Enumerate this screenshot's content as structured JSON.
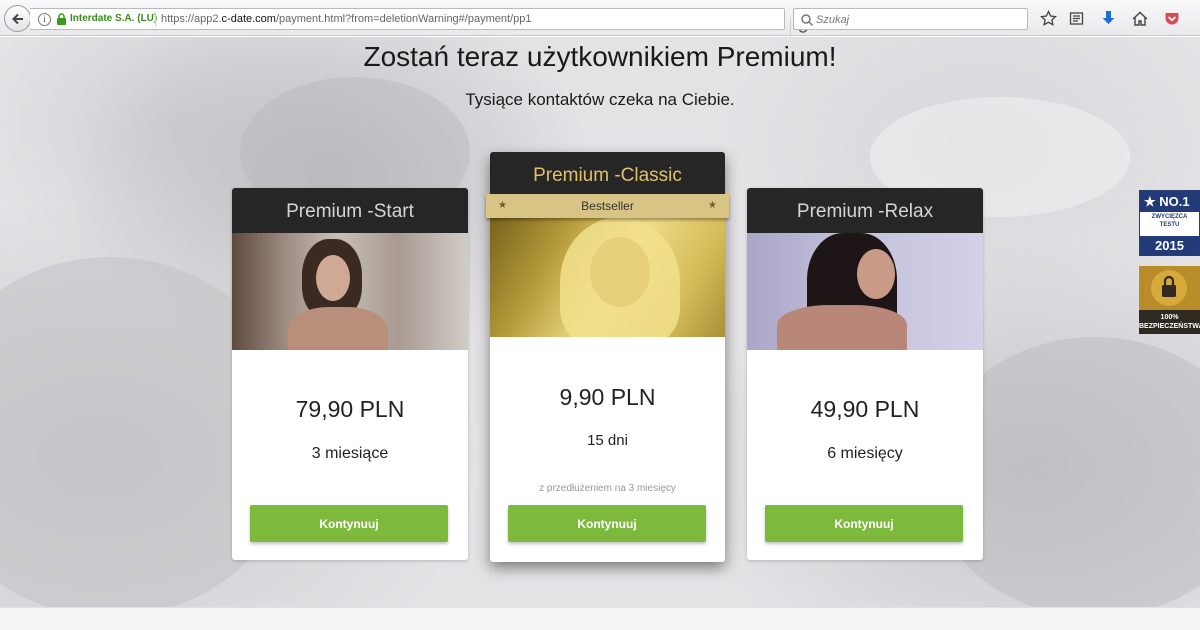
{
  "browser": {
    "site_identity": "Interdate S.A. (LU)",
    "url_prefix": "https://app2.",
    "url_domain": "c-date.com",
    "url_suffix": "/payment.html?from=deletionWarning#/payment/pp1",
    "search_placeholder": "Szukaj"
  },
  "page": {
    "title": "Zostań teraz użytkownikiem Premium!",
    "subtitle": "Tysiące kontaktów czeka na Ciebie."
  },
  "plans": [
    {
      "name": "Premium -Start",
      "price": "79,90 PLN",
      "period": "3 miesiące",
      "button": "Kontynuuj"
    },
    {
      "name": "Premium -Classic",
      "ribbon": "Bestseller",
      "price": "9,90 PLN",
      "period": "15 dni",
      "note": "z przedłużeniem na 3 miesięcy",
      "button": "Kontynuuj"
    },
    {
      "name": "Premium -Relax",
      "price": "49,90 PLN",
      "period": "6 miesięcy",
      "button": "Kontynuuj"
    }
  ],
  "badges": {
    "award_top": "NO.1",
    "award_line1": "ZWYCIĘZCA",
    "award_line2": "TESTU",
    "award_year": "2015",
    "secure_line1": "100%",
    "secure_line2": "BEZPIECZEŃSTWA"
  },
  "colors": {
    "cta_green": "#7cb93c",
    "header_dark": "#262626",
    "classic_gold": "#e0c06a",
    "ribbon_gold": "#d8c585"
  },
  "icons": [
    "back-arrow-icon",
    "info-icon",
    "lock-icon",
    "reload-icon",
    "search-icon",
    "star-icon",
    "reader-icon",
    "download-icon",
    "home-icon",
    "pocket-icon",
    "padlock-icon"
  ]
}
